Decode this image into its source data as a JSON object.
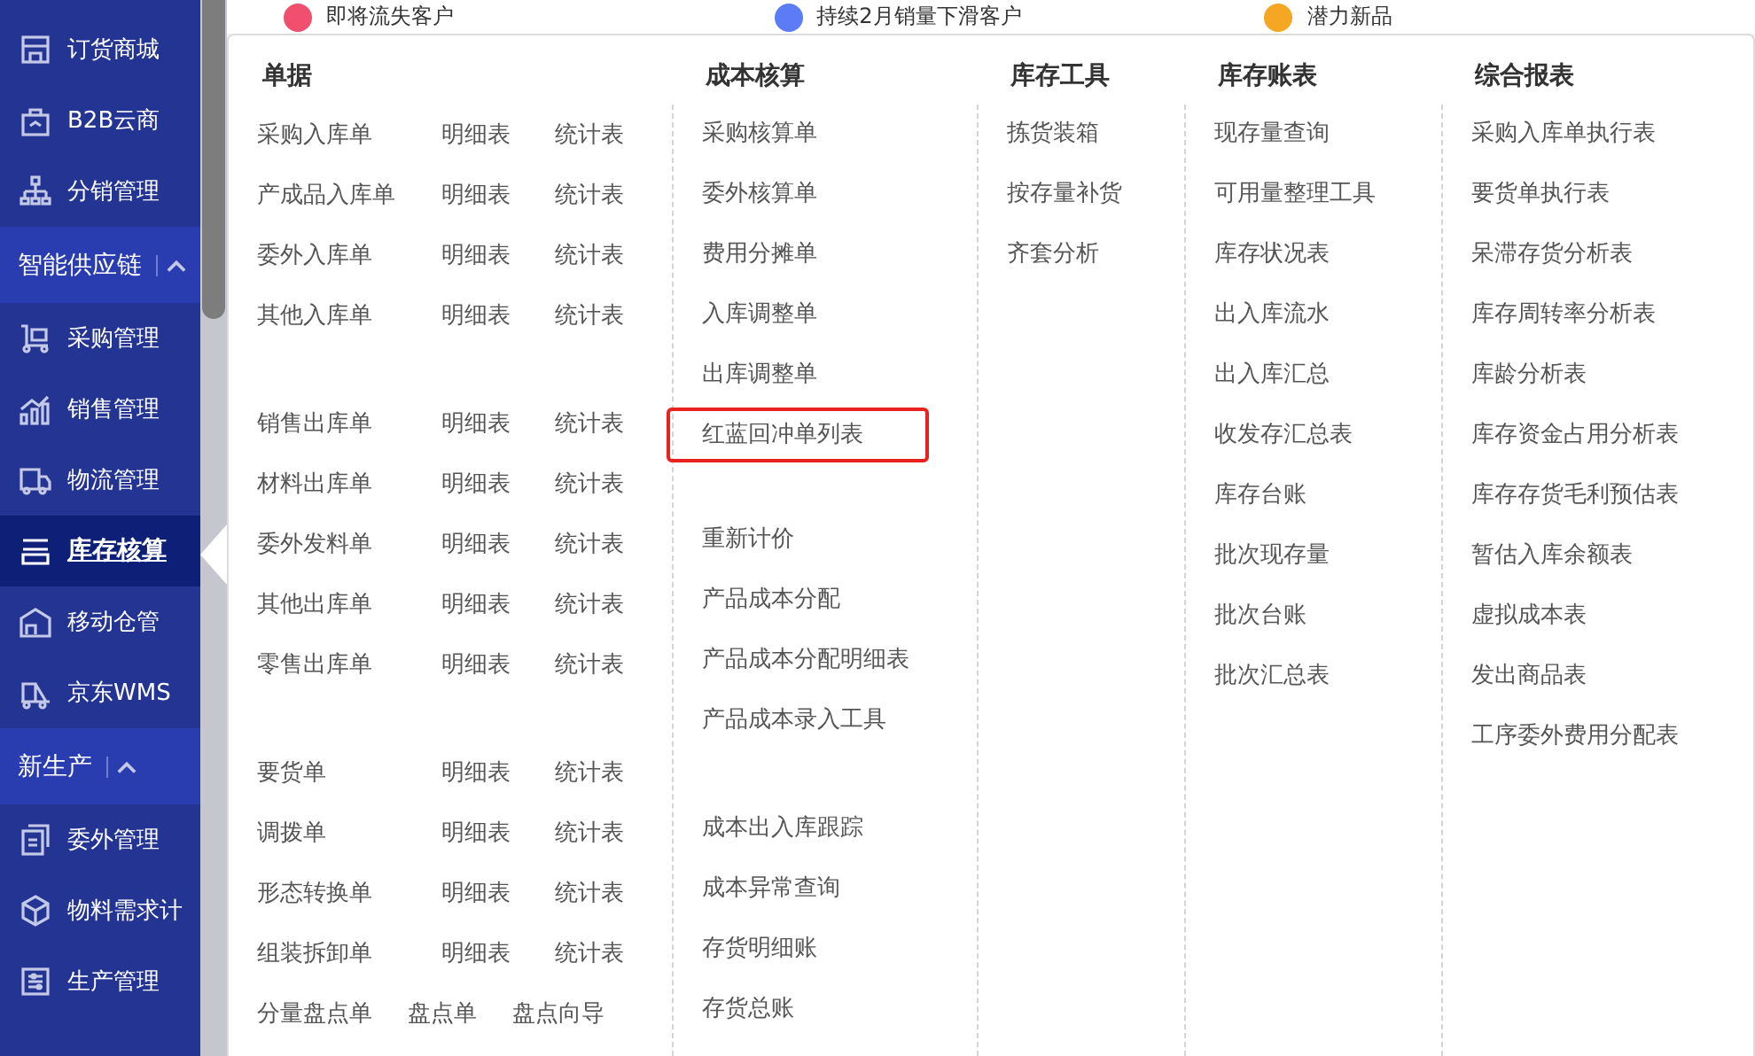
{
  "top_strip": [
    {
      "label": "即将流失客户",
      "color": "#f0506e"
    },
    {
      "label": "持续2月销量下滑客户",
      "color": "#5b7cf5"
    },
    {
      "label": "潜力新品",
      "color": "#f5a623"
    }
  ],
  "sidebar": {
    "items": [
      {
        "kind": "item",
        "label": "订货商城",
        "selected": false
      },
      {
        "kind": "item",
        "label": "B2B云商",
        "selected": false
      },
      {
        "kind": "item",
        "label": "分销管理",
        "selected": false
      },
      {
        "kind": "section",
        "label": "智能供应链",
        "expanded": true
      },
      {
        "kind": "item",
        "label": "采购管理",
        "selected": false
      },
      {
        "kind": "item",
        "label": "销售管理",
        "selected": false
      },
      {
        "kind": "item",
        "label": "物流管理",
        "selected": false
      },
      {
        "kind": "item",
        "label": "库存核算",
        "selected": true
      },
      {
        "kind": "item",
        "label": "移动仓管",
        "selected": false
      },
      {
        "kind": "item",
        "label": "京东WMS",
        "selected": false
      },
      {
        "kind": "section",
        "label": "新生产",
        "expanded": true
      },
      {
        "kind": "item",
        "label": "委外管理",
        "selected": false
      },
      {
        "kind": "item",
        "label": "物料需求计",
        "selected": false
      },
      {
        "kind": "item",
        "label": "生产管理",
        "selected": false
      }
    ]
  },
  "menu": {
    "columns": [
      {
        "title": "单据",
        "groups": [
          [
            {
              "kind": "grid",
              "cells": [
                "采购入库单",
                "明细表",
                "统计表"
              ]
            },
            {
              "kind": "grid",
              "cells": [
                "产成品入库单",
                "明细表",
                "统计表"
              ]
            },
            {
              "kind": "grid",
              "cells": [
                "委外入库单",
                "明细表",
                "统计表"
              ]
            },
            {
              "kind": "grid",
              "cells": [
                "其他入库单",
                "明细表",
                "统计表"
              ]
            }
          ],
          [
            {
              "kind": "grid",
              "cells": [
                "销售出库单",
                "明细表",
                "统计表"
              ]
            },
            {
              "kind": "grid",
              "cells": [
                "材料出库单",
                "明细表",
                "统计表"
              ]
            },
            {
              "kind": "grid",
              "cells": [
                "委外发料单",
                "明细表",
                "统计表"
              ]
            },
            {
              "kind": "grid",
              "cells": [
                "其他出库单",
                "明细表",
                "统计表"
              ]
            },
            {
              "kind": "grid",
              "cells": [
                "零售出库单",
                "明细表",
                "统计表"
              ]
            }
          ],
          [
            {
              "kind": "grid",
              "cells": [
                "要货单",
                "明细表",
                "统计表"
              ]
            },
            {
              "kind": "grid",
              "cells": [
                "调拨单",
                "明细表",
                "统计表"
              ]
            },
            {
              "kind": "grid",
              "cells": [
                "形态转换单",
                "明细表",
                "统计表"
              ]
            },
            {
              "kind": "grid",
              "cells": [
                "组装拆卸单",
                "明细表",
                "统计表"
              ]
            },
            {
              "kind": "inline",
              "cells": [
                "分量盘点单",
                "盘点单",
                "盘点向导"
              ]
            }
          ]
        ]
      },
      {
        "title": "成本核算",
        "groups": [
          [
            {
              "label": "采购核算单",
              "highlighted": false
            },
            {
              "label": "委外核算单",
              "highlighted": false
            },
            {
              "label": "费用分摊单",
              "highlighted": false
            },
            {
              "label": "入库调整单",
              "highlighted": false
            },
            {
              "label": "出库调整单",
              "highlighted": false
            },
            {
              "label": "红蓝回冲单列表",
              "highlighted": true
            }
          ],
          [
            {
              "label": "重新计价",
              "highlighted": false
            },
            {
              "label": "产品成本分配",
              "highlighted": false
            },
            {
              "label": "产品成本分配明细表",
              "highlighted": false
            },
            {
              "label": "产品成本录入工具",
              "highlighted": false
            }
          ],
          [
            {
              "label": "成本出入库跟踪",
              "highlighted": false
            },
            {
              "label": "成本异常查询",
              "highlighted": false
            },
            {
              "label": "存货明细账",
              "highlighted": false
            },
            {
              "label": "存货总账",
              "highlighted": false
            }
          ]
        ]
      },
      {
        "title": "库存工具",
        "groups": [
          [
            {
              "label": "拣货装箱",
              "highlighted": false
            },
            {
              "label": "按存量补货",
              "highlighted": false
            },
            {
              "label": "齐套分析",
              "highlighted": false
            }
          ]
        ]
      },
      {
        "title": "库存账表",
        "groups": [
          [
            {
              "label": "现存量查询",
              "highlighted": false
            },
            {
              "label": "可用量整理工具",
              "highlighted": false
            },
            {
              "label": "库存状况表",
              "highlighted": false
            },
            {
              "label": "出入库流水",
              "highlighted": false
            },
            {
              "label": "出入库汇总",
              "highlighted": false
            },
            {
              "label": "收发存汇总表",
              "highlighted": false
            },
            {
              "label": "库存台账",
              "highlighted": false
            },
            {
              "label": "批次现存量",
              "highlighted": false
            },
            {
              "label": "批次台账",
              "highlighted": false
            },
            {
              "label": "批次汇总表",
              "highlighted": false
            }
          ]
        ]
      },
      {
        "title": "综合报表",
        "groups": [
          [
            {
              "label": "采购入库单执行表",
              "highlighted": false
            },
            {
              "label": "要货单执行表",
              "highlighted": false
            },
            {
              "label": "呆滞存货分析表",
              "highlighted": false
            },
            {
              "label": "库存周转率分析表",
              "highlighted": false
            },
            {
              "label": "库龄分析表",
              "highlighted": false
            },
            {
              "label": "库存资金占用分析表",
              "highlighted": false
            },
            {
              "label": "库存存货毛利预估表",
              "highlighted": false
            },
            {
              "label": "暂估入库余额表",
              "highlighted": false
            },
            {
              "label": "虚拟成本表",
              "highlighted": false
            },
            {
              "label": "发出商品表",
              "highlighted": false
            },
            {
              "label": "工序委外费用分配表",
              "highlighted": false
            }
          ]
        ]
      }
    ]
  }
}
